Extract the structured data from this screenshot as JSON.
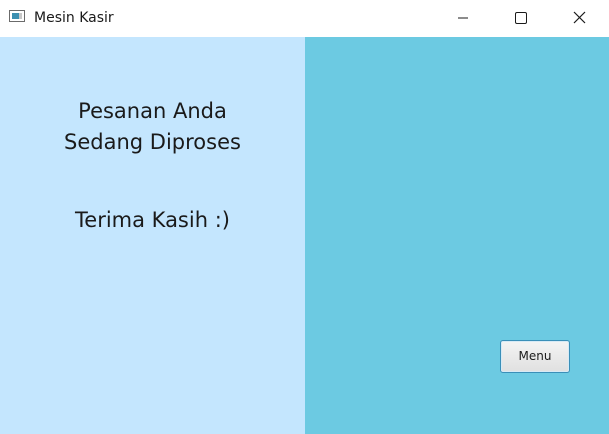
{
  "window": {
    "title": "Mesin Kasir",
    "icon": "app-window-icon",
    "controls": [
      "minimize-icon",
      "maximize-icon",
      "close-icon"
    ]
  },
  "left_pane": {
    "line1": "Pesanan Anda",
    "line2": "Sedang Diproses",
    "line3": "Terima Kasih :)"
  },
  "right_pane": {
    "menu_label": "Menu"
  },
  "colors": {
    "left_pane_bg": "#c4e6fe",
    "right_pane_bg": "#6ccae2",
    "button_border": "#3a8fb8"
  }
}
